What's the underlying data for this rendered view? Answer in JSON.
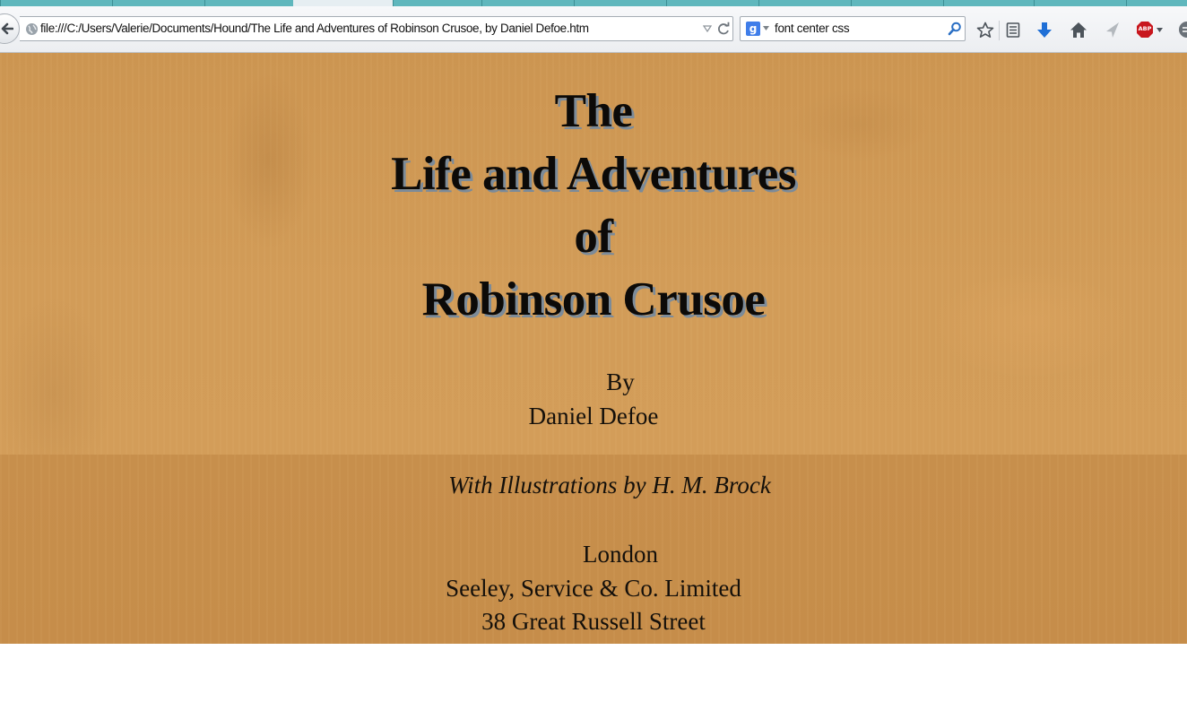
{
  "browser": {
    "url": "file:///C:/Users/Valerie/Documents/Hound/The Life and Adventures of Robinson Crusoe, by Daniel Defoe.htm",
    "search_value": "font center css",
    "search_engine_glyph": "g",
    "icons": [
      "back-arrow-icon",
      "globe-icon",
      "dropdown-arrow-icon",
      "reload-icon",
      "google-icon",
      "magnifier-icon",
      "bookmark-star-icon",
      "reading-list-icon",
      "download-arrow-icon",
      "home-icon",
      "send-arrow-icon",
      "adblock-plus-icon",
      "menu-icon"
    ],
    "adblock_label": "ABP",
    "accent_color": "#5fb7bd",
    "download_color": "#1f6fd6",
    "adblock_color": "#c8161d"
  },
  "page": {
    "background_color": "#d29c58",
    "title_lines": [
      "The",
      "Life and Adventures",
      "of",
      "Robinson Crusoe"
    ],
    "by": "By",
    "author": "Daniel Defoe",
    "illustrations": "With Illustrations by H. M. Brock",
    "imprint": [
      "London",
      "Seeley, Service & Co. Limited",
      "38 Great Russell Street"
    ]
  }
}
